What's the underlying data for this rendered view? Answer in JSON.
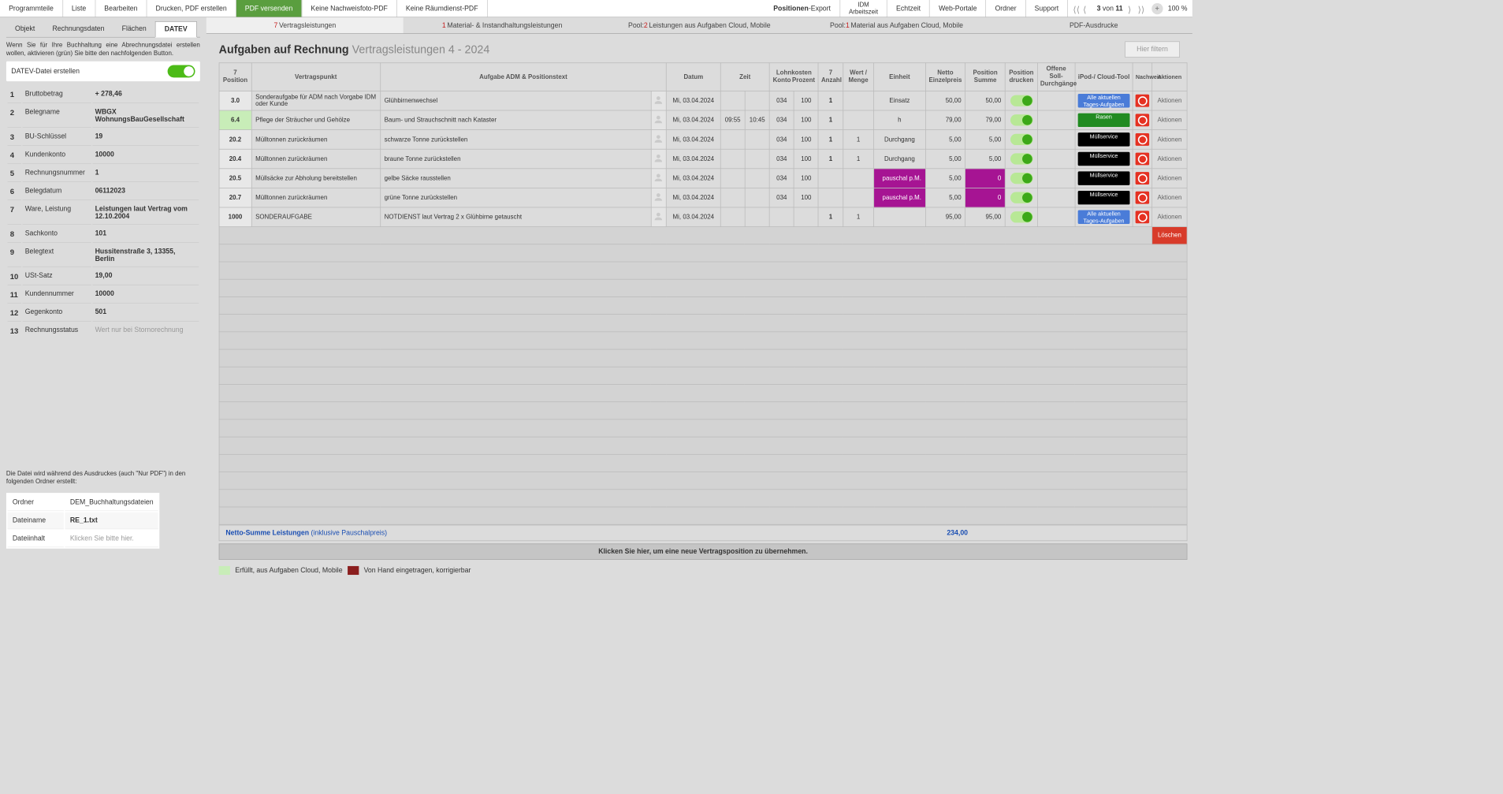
{
  "topbar": {
    "items_left": [
      "Programmteile",
      "Liste",
      "Bearbeiten",
      "Drucken, PDF erstellen",
      "PDF versenden",
      "Keine Nachweisfoto-PDF",
      "Keine Räumdienst-PDF"
    ],
    "green_index": 4,
    "positionen_export_bold": "Positionen",
    "positionen_export_rest": "-Export",
    "idm_line1": "IDM",
    "idm_line2": "Arbeitszeit",
    "items_right": [
      "Echtzeit",
      "Web-Portale",
      "Ordner",
      "Support"
    ],
    "page_cur": "3",
    "page_of_lbl": "von",
    "page_total": "11",
    "zoom": "100 %"
  },
  "left_tabs": [
    "Objekt",
    "Rechnungsdaten",
    "Flächen",
    "DATEV"
  ],
  "left_active": 3,
  "left_info": "Wenn Sie für Ihre Buchhaltung eine Abrechnungsdatei erstellen wollen, aktivieren (grün) Sie bitte den nachfolgenden Button.",
  "toggle_label": "DATEV-Datei erstellen",
  "kv": [
    {
      "n": "1",
      "k": "Bruttobetrag",
      "v": "+ 278,46",
      "bold": true
    },
    {
      "n": "2",
      "k": "Belegname",
      "v": "WBGX WohnungsBauGesellschaft"
    },
    {
      "n": "3",
      "k": "BU-Schlüssel",
      "v": "19",
      "bold": true
    },
    {
      "n": "4",
      "k": "Kundenkonto",
      "v": "10000",
      "bold": true
    },
    {
      "n": "5",
      "k": "Rechnungsnummer",
      "v": "1",
      "bold": true
    },
    {
      "n": "6",
      "k": "Belegdatum",
      "v": "06112023",
      "bold": true
    },
    {
      "n": "7",
      "k": "Ware, Leistung",
      "v": "Leistungen laut Vertrag vom 12.10.2004"
    },
    {
      "n": "8",
      "k": "Sachkonto",
      "v": "101",
      "bold": true
    },
    {
      "n": "9",
      "k": "Belegtext",
      "v": "Hussitenstraße 3, 13355, Berlin"
    },
    {
      "n": "10",
      "k": "USt-Satz",
      "v": "19,00",
      "bold": true
    },
    {
      "n": "11",
      "k": "Kundennummer",
      "v": "10000",
      "bold": true
    },
    {
      "n": "12",
      "k": "Gegenkonto",
      "v": "501",
      "bold": true
    },
    {
      "n": "13",
      "k": "Rechnungsstatus",
      "v": "Wert nur bei Stornorechnung",
      "light": true
    }
  ],
  "left_bottom": "Die Datei wird während des Ausdruckes (auch \"Nur PDF\") in den folgenden Ordner erstellt:",
  "file_rows": [
    {
      "k": "Ordner",
      "v": "DEM_Buchhaltungsdateien"
    },
    {
      "k": "Dateiname",
      "v": "RE_1.txt",
      "bold": true
    },
    {
      "k": "Dateiinhalt",
      "v": "Klicken Sie bitte hier.",
      "ph": true
    }
  ],
  "maintabs": [
    {
      "red": "7",
      "label": "Vertragsleistungen",
      "active": true
    },
    {
      "red": "1",
      "label": "Material- & Instandhaltungsleistungen"
    },
    {
      "prefix": "Pool: ",
      "red": "2",
      "label": "Leistungen aus Aufgaben Cloud, Mobile"
    },
    {
      "prefix": "Pool: ",
      "red": "1",
      "label": "Material aus Aufgaben Cloud, Mobile"
    },
    {
      "label": "PDF-Ausdrucke"
    }
  ],
  "header_title": "Aufgaben auf Rechnung",
  "header_sub": "Vertragsleistungen 4 - 2024",
  "filter": "Hier filtern",
  "cols": {
    "pos_top": "7",
    "pos": "Position",
    "vert": "Vertragspunkt",
    "auf": "Aufgabe ADM & Positionstext",
    "datum": "Datum",
    "zeit": "Zeit",
    "lohn": "Lohnkosten",
    "konto": "Konto",
    "proz": "Prozent",
    "anz_top": "7",
    "anz": "Anzahl",
    "wert": "Wert / Menge",
    "einheit": "Einheit",
    "netto": "Netto",
    "preis": "Einzelpreis",
    "sum": "Position Summe",
    "druck": "Position drucken",
    "durch": "Offene Soll-Durchgänge",
    "pod": "iPod-/ Cloud-Tool",
    "nach": "Nachweis",
    "akt": "Aktionen"
  },
  "rows": [
    {
      "pos": "3.0",
      "vert": "Sonderaufgabe für ADM nach Vorgabe IDM oder Kunde",
      "auf": "Glühbirnenwechsel",
      "datum": "Mi, 03.04.2024",
      "z1": "",
      "z2": "",
      "konto": "034",
      "proz": "100",
      "anz": "1",
      "wert": "",
      "einh": "Einsatz",
      "preis": "50,00",
      "sum": "50,00",
      "pill": "Alle aktuellen Tages-Aufgaben",
      "pc": "blue"
    },
    {
      "pos": "6.4",
      "posgreen": true,
      "vert": "Pflege der Sträucher und Gehölze",
      "auf": "Baum- und Strauchschnitt nach Kataster",
      "datum": "Mi, 03.04.2024",
      "z1": "09:55",
      "z2": "10:45",
      "konto": "034",
      "proz": "100",
      "anz": "1",
      "wert": "",
      "einh": "h",
      "preis": "79,00",
      "sum": "79,00",
      "pill": "Rasen",
      "pc": "green"
    },
    {
      "pos": "20.2",
      "vert": "Mülltonnen zurückräumen",
      "auf": "schwarze Tonne zurückstellen",
      "datum": "Mi, 03.04.2024",
      "z1": "",
      "z2": "",
      "konto": "034",
      "proz": "100",
      "anz": "1",
      "wert": "1",
      "einh": "Durchgang",
      "preis": "5,00",
      "sum": "5,00",
      "pill": "Müllservice",
      "pc": "black"
    },
    {
      "pos": "20.4",
      "vert": "Mülltonnen zurückräumen",
      "auf": "braune Tonne zurückstellen",
      "datum": "Mi, 03.04.2024",
      "z1": "",
      "z2": "",
      "konto": "034",
      "proz": "100",
      "anz": "1",
      "wert": "1",
      "einh": "Durchgang",
      "preis": "5,00",
      "sum": "5,00",
      "pill": "Müllservice",
      "pc": "black"
    },
    {
      "pos": "20.5",
      "vert": "Müllsäcke zur Abholung bereitstellen",
      "auf": "gelbe Säcke rausstellen",
      "datum": "Mi, 03.04.2024",
      "z1": "",
      "z2": "",
      "konto": "034",
      "proz": "100",
      "anz": "",
      "wert": "",
      "einh": "pauschal p.M.",
      "preis": "5,00",
      "sum": "0",
      "pill": "Müllservice",
      "pc": "black",
      "pauschal": true
    },
    {
      "pos": "20.7",
      "vert": "Mülltonnen zurückräumen",
      "auf": "grüne Tonne zurückstellen",
      "datum": "Mi, 03.04.2024",
      "z1": "",
      "z2": "",
      "konto": "034",
      "proz": "100",
      "anz": "",
      "wert": "",
      "einh": "pauschal p.M.",
      "preis": "5,00",
      "sum": "0",
      "pill": "Müllservice",
      "pc": "black",
      "pauschal": true
    },
    {
      "pos": "1000",
      "vert": "SONDERAUFGABE",
      "auf": "NOTDIENST laut Vertrag 2 x Glühbirne getauscht",
      "datum": "Mi, 03.04.2024",
      "z1": "",
      "z2": "",
      "konto": "",
      "proz": "",
      "anz": "1",
      "wert": "1",
      "einh": "",
      "preis": "95,00",
      "sum": "95,00",
      "pill": "Alle aktuellen Tages-Aufgaben",
      "pc": "blue"
    }
  ],
  "loeschen": "Löschen",
  "akt_label": "Aktionen",
  "sum_label": "Netto-Summe Leistungen",
  "sum_paren": "(inklusive Pauschalpreis)",
  "sum_val": "234,00",
  "click_row": "Klicken Sie hier, um eine neue Vertragsposition zu übernehmen.",
  "legend1": "Erfüllt, aus Aufgaben Cloud, Mobile",
  "legend2": "Von Hand eingetragen, korrigierbar"
}
